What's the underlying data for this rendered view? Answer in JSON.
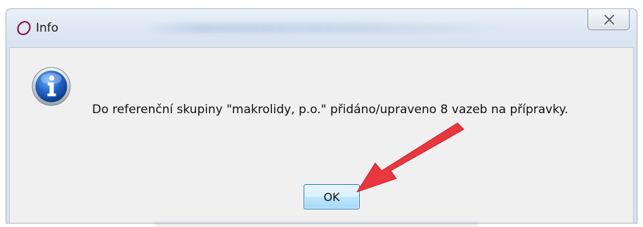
{
  "window": {
    "title": "Info",
    "close_label": "Close"
  },
  "dialog": {
    "message": "Do referenční skupiny \"makrolidy, p.o.\" přidáno/upraveno 8 vazeb na přípravky.",
    "ok_label": "OK",
    "icon": "information-icon"
  },
  "colors": {
    "annotation_arrow": "#e8373f",
    "info_icon_blue": "#1f5fb8",
    "button_border": "#3c7fb1"
  }
}
